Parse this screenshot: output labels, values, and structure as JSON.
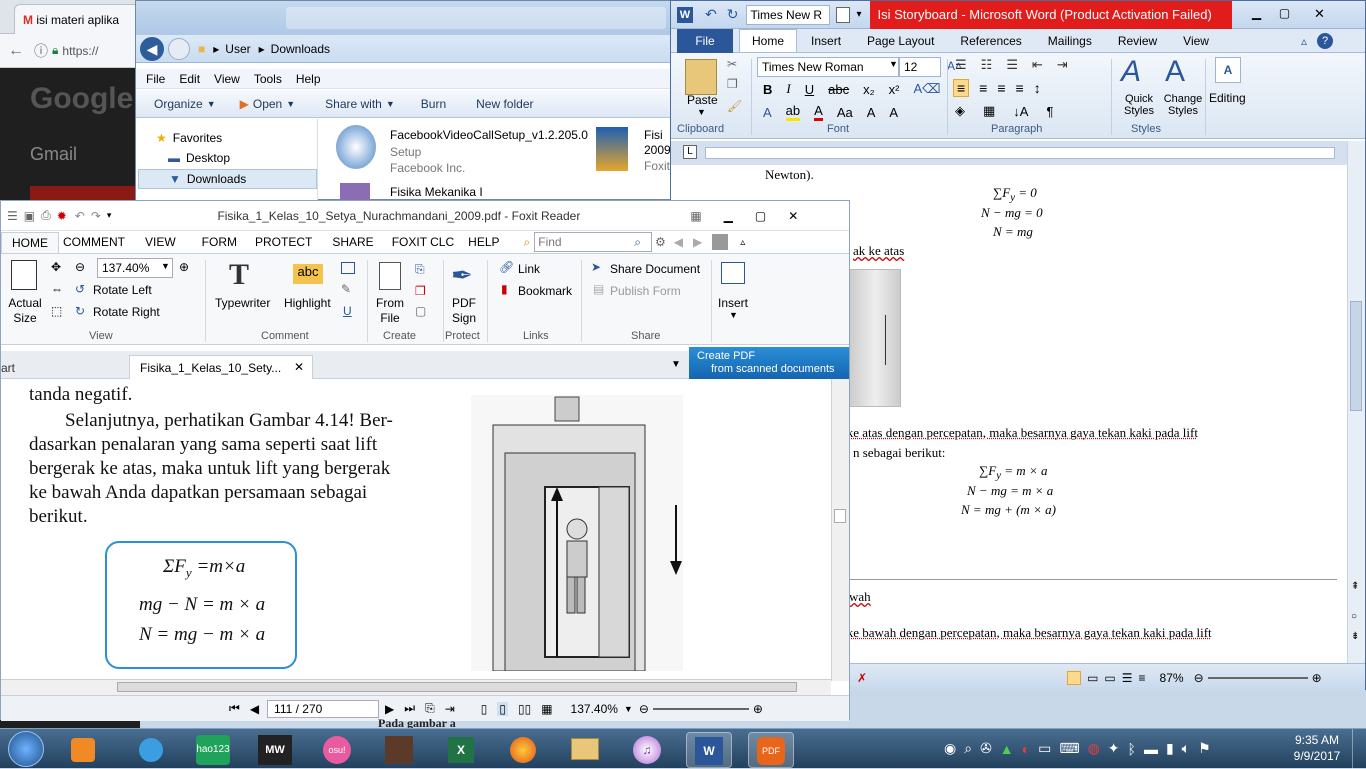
{
  "browser": {
    "tab_title": "isi materi aplika",
    "address": "https://",
    "logo": "Google",
    "gmail": "Gmail"
  },
  "explorer": {
    "breadcrumb": [
      "User",
      "Downloads"
    ],
    "menu": [
      "File",
      "Edit",
      "View",
      "Tools",
      "Help"
    ],
    "commands": [
      "Organize",
      "Open",
      "Share with",
      "Burn",
      "New folder"
    ],
    "nav": [
      "Favorites",
      "Desktop",
      "Downloads"
    ],
    "files": [
      {
        "name": "FacebookVideoCallSetup_v1.2.205.0",
        "type": "Setup",
        "company": "Facebook Inc."
      },
      {
        "name": "Fisika Mekanika I"
      },
      {
        "name": "Fisi",
        "sub": "2009"
      },
      {
        "name": "Foxit"
      }
    ]
  },
  "word": {
    "title": "Isi Storyboard - Microsoft Word (Product Activation Failed)",
    "qat_font": "Times New R",
    "tabs": [
      "File",
      "Home",
      "Insert",
      "Page Layout",
      "References",
      "Mailings",
      "Review",
      "View"
    ],
    "font_name": "Times New Roman",
    "font_size": "12",
    "groups": {
      "clipboard": "Clipboard",
      "font": "Font",
      "paragraph": "Paragraph",
      "styles": "Styles"
    },
    "buttons": {
      "paste": "Paste",
      "quick_styles": "Quick Styles",
      "change_styles": "Change Styles",
      "editing": "Editing"
    },
    "doc": {
      "line1": "Newton).",
      "eq1": [
        "∑F",
        "y",
        " = 0"
      ],
      "eq2": "N − mg = 0",
      "eq3": "N = mg",
      "frag1": "ak ke atas",
      "frag2": "k ke atas dengan percepatan, maka besarnya gaya tekan kaki pada lift",
      "frag3": "n sebagai berikut:",
      "eq4": "∑F",
      "eq4b": " = m × a",
      "eq5": "N − mg = m × a",
      "eq6": "N = mg + (m × a)",
      "frag4": "wah",
      "frag5": "k ke bawah dengan percepatan, maka besarnya gaya tekan kaki pada lift"
    },
    "zoom": "87%"
  },
  "foxit": {
    "title": "Fisika_1_Kelas_10_Setya_Nurachmandani_2009.pdf - Foxit Reader",
    "tabs": [
      "HOME",
      "COMMENT",
      "VIEW",
      "FORM",
      "PROTECT",
      "SHARE",
      "FOXIT CLC",
      "HELP"
    ],
    "find_placeholder": "Find",
    "ribbon": {
      "actual_size": "Actual Size",
      "zoom": "137.40%",
      "rotate_left": "Rotate Left",
      "rotate_right": "Rotate Right",
      "view": "View",
      "typewriter": "Typewriter",
      "highlight": "Highlight",
      "comment": "Comment",
      "from_file": "From File",
      "create": "Create",
      "pdf_sign": "PDF Sign",
      "protect": "Protect",
      "link": "Link",
      "bookmark": "Bookmark",
      "links": "Links",
      "share_document": "Share Document",
      "publish_form": "Publish Form",
      "share": "Share",
      "insert": "Insert"
    },
    "doc_tabs": [
      "art",
      "Fisika_1_Kelas_10_Sety..."
    ],
    "create_pdf": [
      "Create PDF",
      "from scanned documents"
    ],
    "page_text": {
      "top": "tanda  negatif.",
      "p1": "Selanjutnya, perhatikan Gambar 4.14! Ber-",
      "p2": "dasarkan penalaran yang sama seperti saat lift",
      "p3": "bergerak ke atas, maka untuk lift yang bergerak",
      "p4": "ke bawah Anda dapatkan persamaan sebagai",
      "p5": "berikut.",
      "box1": "ΣF",
      "box1sub": "y",
      "box1b": " =m×a",
      "box2": "mg − N = m × a",
      "box3": "N = mg − m × a"
    },
    "page": "111 / 270",
    "zoom": "137.40%"
  },
  "taskbar": {
    "time": "9:35 AM",
    "date": "9/9/2017",
    "apps": [
      "hao123",
      "MW",
      "osu!"
    ]
  },
  "behind": "Pada gambar a"
}
